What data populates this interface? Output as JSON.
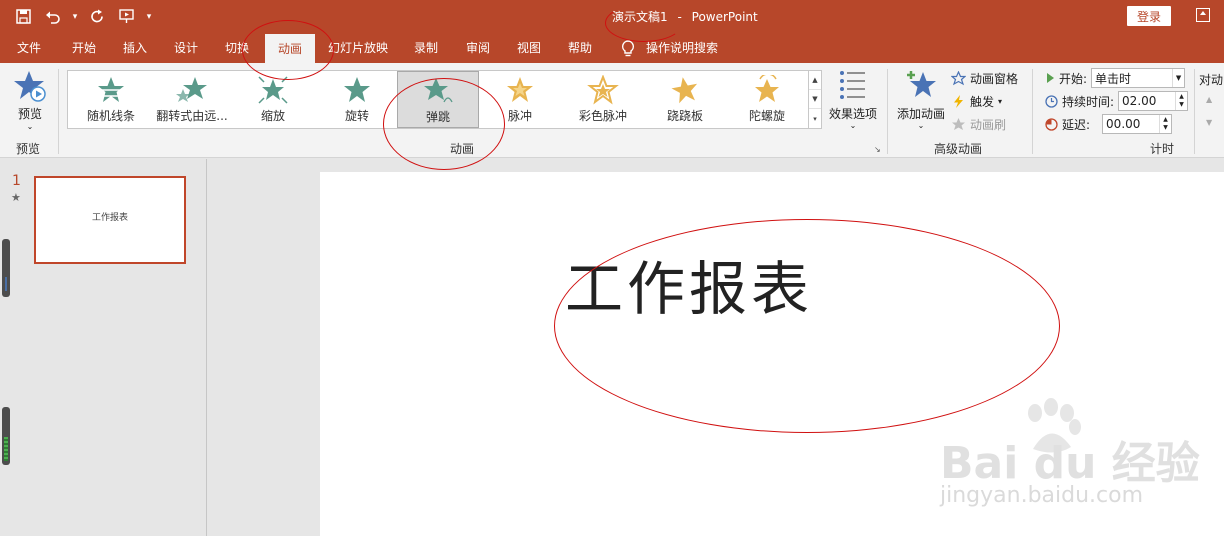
{
  "titlebar": {
    "doc_name": "演示文稿1",
    "separator": "-",
    "app_name": "PowerPoint",
    "login_label": "登录"
  },
  "tabs": [
    {
      "label": "文件"
    },
    {
      "label": "开始"
    },
    {
      "label": "插入"
    },
    {
      "label": "设计"
    },
    {
      "label": "切换"
    },
    {
      "label": "动画",
      "active": true
    },
    {
      "label": "幻灯片放映"
    },
    {
      "label": "录制"
    },
    {
      "label": "审阅"
    },
    {
      "label": "视图"
    },
    {
      "label": "帮助"
    },
    {
      "label": "操作说明搜索"
    }
  ],
  "ribbon": {
    "preview": {
      "button_label": "预览",
      "group_label": "预览"
    },
    "animation_group": {
      "group_label": "动画",
      "items": [
        {
          "label": "随机线条",
          "color": "#5a9a8a"
        },
        {
          "label": "翻转式由远...",
          "color": "#5a9a8a"
        },
        {
          "label": "缩放",
          "color": "#5a9a8a"
        },
        {
          "label": "旋转",
          "color": "#5a9a8a"
        },
        {
          "label": "弹跳",
          "color": "#5a9a8a",
          "selected": true
        },
        {
          "label": "脉冲",
          "color": "#e8b450"
        },
        {
          "label": "彩色脉冲",
          "color": "#e8b450"
        },
        {
          "label": "跷跷板",
          "color": "#e8b450"
        },
        {
          "label": "陀螺旋",
          "color": "#e8b450"
        }
      ],
      "effect_options_label": "效果选项"
    },
    "advanced_group": {
      "group_label": "高级动画",
      "add_animation_label": "添加动画",
      "animation_pane_label": "动画窗格",
      "trigger_label": "触发",
      "animation_painter_label": "动画刷"
    },
    "timing_group": {
      "group_label": "计时",
      "start_label": "开始:",
      "start_value": "单击时",
      "duration_label": "持续时间:",
      "duration_value": "02.00",
      "delay_label": "延迟:",
      "delay_value": "00.00",
      "reorder_label": "对动"
    }
  },
  "thumbnails": {
    "slide_number": "1",
    "thumb_text": "工作报表"
  },
  "slide": {
    "title": "工作报表"
  },
  "watermark": {
    "main": "Bai du 经验",
    "sub": "jingyan.baidu.com"
  },
  "colors": {
    "accent": "#b7472a",
    "annotation": "#d01010"
  }
}
